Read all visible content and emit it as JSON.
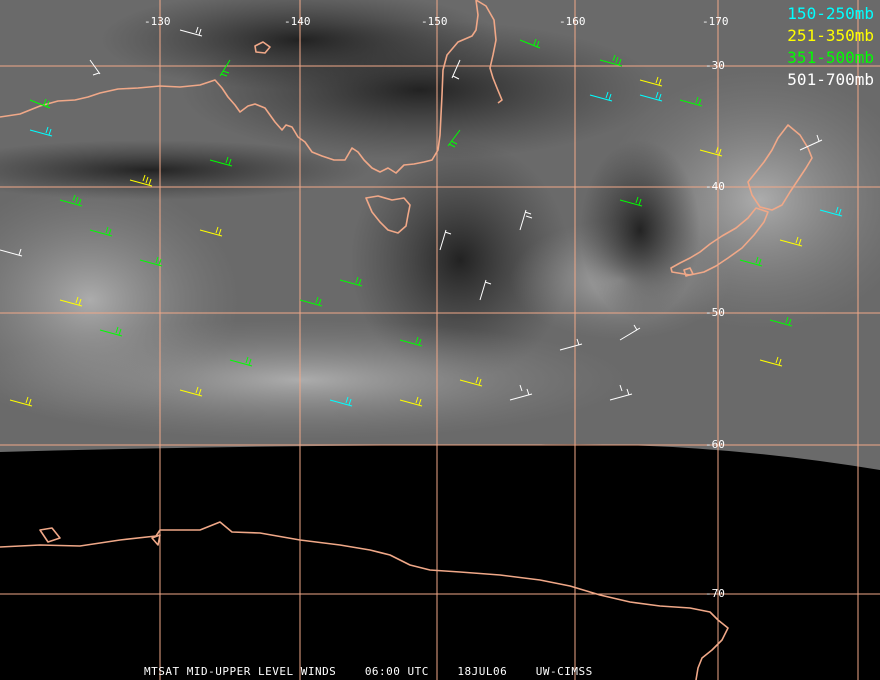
{
  "map": {
    "longitude_labels": [
      "-130",
      "-140",
      "-150",
      "-160",
      "-170"
    ],
    "latitude_labels": [
      "-30",
      "-40",
      "-50",
      "-60",
      "-70"
    ],
    "colors": {
      "grid": "#f0a888",
      "coast": "#f0a888",
      "background": "#000000"
    }
  },
  "legend": [
    {
      "label": "150-250mb",
      "color": "#00ffff"
    },
    {
      "label": "251-350mb",
      "color": "#ffff00"
    },
    {
      "label": "351-500mb",
      "color": "#00ff00"
    },
    {
      "label": "501-700mb",
      "color": "#ffffff"
    }
  ],
  "footer": {
    "product": "MTSAT MID-UPPER LEVEL WINDS",
    "time": "06:00 UTC",
    "date": "18JUL06",
    "source": "UW-CIMSS"
  }
}
